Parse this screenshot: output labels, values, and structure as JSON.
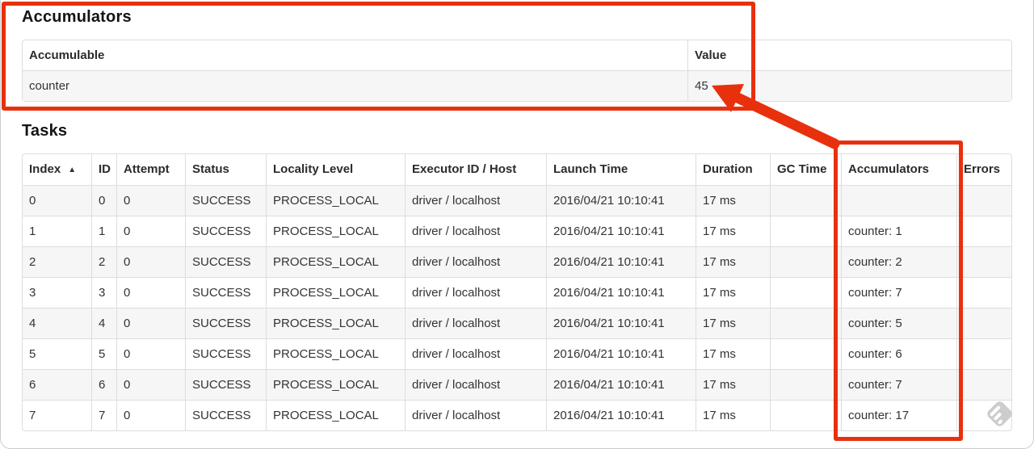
{
  "accumulators_section": {
    "title": "Accumulators",
    "table": {
      "headers": [
        "Accumulable",
        "Value"
      ],
      "rows": [
        [
          "counter",
          "45"
        ]
      ]
    }
  },
  "tasks_section": {
    "title": "Tasks",
    "table": {
      "headers": [
        "Index",
        "ID",
        "Attempt",
        "Status",
        "Locality Level",
        "Executor ID / Host",
        "Launch Time",
        "Duration",
        "GC Time",
        "Accumulators",
        "Errors"
      ],
      "sorted_column": "Index",
      "sort_indicator": "▲",
      "rows": [
        [
          "0",
          "0",
          "0",
          "SUCCESS",
          "PROCESS_LOCAL",
          "driver / localhost",
          "2016/04/21 10:10:41",
          "17 ms",
          "",
          "",
          ""
        ],
        [
          "1",
          "1",
          "0",
          "SUCCESS",
          "PROCESS_LOCAL",
          "driver / localhost",
          "2016/04/21 10:10:41",
          "17 ms",
          "",
          "counter: 1",
          ""
        ],
        [
          "2",
          "2",
          "0",
          "SUCCESS",
          "PROCESS_LOCAL",
          "driver / localhost",
          "2016/04/21 10:10:41",
          "17 ms",
          "",
          "counter: 2",
          ""
        ],
        [
          "3",
          "3",
          "0",
          "SUCCESS",
          "PROCESS_LOCAL",
          "driver / localhost",
          "2016/04/21 10:10:41",
          "17 ms",
          "",
          "counter: 7",
          ""
        ],
        [
          "4",
          "4",
          "0",
          "SUCCESS",
          "PROCESS_LOCAL",
          "driver / localhost",
          "2016/04/21 10:10:41",
          "17 ms",
          "",
          "counter: 5",
          ""
        ],
        [
          "5",
          "5",
          "0",
          "SUCCESS",
          "PROCESS_LOCAL",
          "driver / localhost",
          "2016/04/21 10:10:41",
          "17 ms",
          "",
          "counter: 6",
          ""
        ],
        [
          "6",
          "6",
          "0",
          "SUCCESS",
          "PROCESS_LOCAL",
          "driver / localhost",
          "2016/04/21 10:10:41",
          "17 ms",
          "",
          "counter: 7",
          ""
        ],
        [
          "7",
          "7",
          "0",
          "SUCCESS",
          "PROCESS_LOCAL",
          "driver / localhost",
          "2016/04/21 10:10:41",
          "17 ms",
          "",
          "counter: 17",
          ""
        ]
      ]
    }
  },
  "annotations": {
    "color": "#e8300d"
  },
  "watermark": {
    "icon": "striped-diamond-badge",
    "color": "#cdcdcd"
  }
}
